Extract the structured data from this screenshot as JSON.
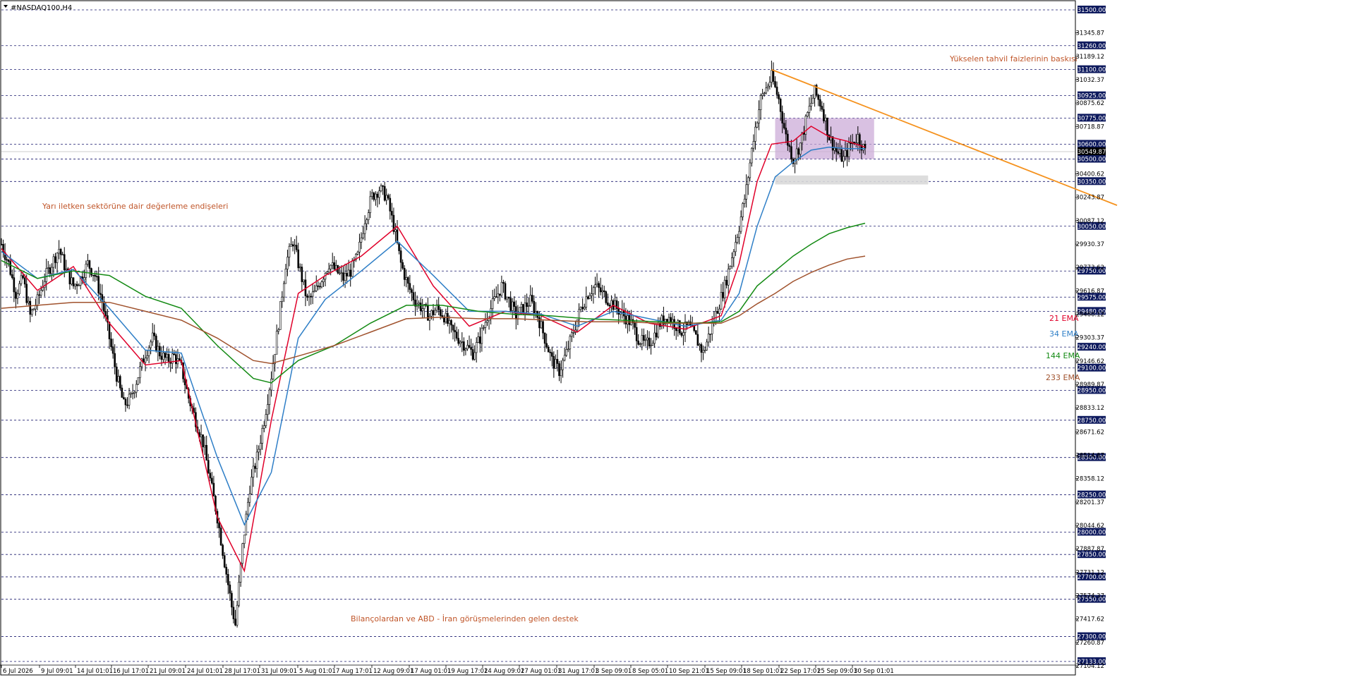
{
  "window": {
    "title": "#NASDAQ100,H4",
    "menu_icon": "triangle-down-icon"
  },
  "colors": {
    "background": "#ffffff",
    "grid_dashed": "#1a1a6e",
    "bull_bear_candles": "#000000",
    "ema21": "#e0002a",
    "ema34": "#2f7fc7",
    "ema144": "#138a13",
    "ema233": "#a0522d",
    "trendline": "#f5921e",
    "zone_fill": "#c9a6d6",
    "support_fill": "#d9d9d9",
    "annotation_text": "#c0562a",
    "price_label_bg": "#0e1a5e",
    "price_label_text": "#ffffff"
  },
  "annotations": {
    "top_right": "Yükselen tahvil faizlerinin baskısı",
    "left": "Yarı iletken sektörüne dair değerleme endişeleri",
    "bottom": "Bilançolardan ve ABD - İran görüşmelerinden gelen destek"
  },
  "legend": {
    "ema21": "21 EMA",
    "ema34": "34 EMA",
    "ema144": "144 EMA",
    "ema233": "233 EMA"
  },
  "chart_data": {
    "type": "candlestick",
    "symbol": "#NASDAQ100",
    "timeframe": "H4",
    "ylim": [
      27104.12,
      31500.0
    ],
    "x_tick_labels": [
      "6 Jul 2026",
      "9 Jul 09:01",
      "14 Jul 01:01",
      "16 Jul 17:01",
      "21 Jul 09:01",
      "24 Jul 01:01",
      "28 Jul 17:01",
      "31 Jul 09:01",
      "5 Aug 01:01",
      "7 Aug 17:01",
      "12 Aug 09:01",
      "17 Aug 01:01",
      "19 Aug 17:01",
      "24 Aug 09:01",
      "27 Aug 01:01",
      "31 Aug 17:01",
      "3 Sep 09:01",
      "8 Sep 05:01",
      "10 Sep 21:01",
      "15 Sep 09:01",
      "18 Sep 01:01",
      "22 Sep 17:01",
      "25 Sep 09:01",
      "30 Sep 01:01"
    ],
    "y_tick_labels": [
      "31345.87",
      "31189.12",
      "31032.37",
      "30875.62",
      "30718.87",
      "30400.62",
      "30243.87",
      "30087.12",
      "29930.37",
      "29773.62",
      "29616.87",
      "29460.12",
      "29303.37",
      "29146.62",
      "28989.87",
      "28833.12",
      "28671.62",
      "28514.87",
      "28358.12",
      "28201.37",
      "28044.62",
      "27887.87",
      "27731.12",
      "27574.37",
      "27417.62",
      "27260.87",
      "27104.12"
    ],
    "horizontal_levels": [
      31500.0,
      31260.0,
      31100.0,
      30925.0,
      30775.0,
      30600.0,
      30500.0,
      30350.0,
      30050.0,
      29750.0,
      29575.0,
      29480.0,
      29240.0,
      29100.0,
      28950.0,
      28750.0,
      28500.0,
      28250.0,
      28000.0,
      27850.0,
      27700.0,
      27550.0,
      27300.0,
      27133.0
    ],
    "current_price": 30549.87,
    "price_points": [
      [
        0,
        29930
      ],
      [
        4,
        29800
      ],
      [
        8,
        29600
      ],
      [
        12,
        29700
      ],
      [
        16,
        29450
      ],
      [
        20,
        29550
      ],
      [
        24,
        29700
      ],
      [
        28,
        29800
      ],
      [
        32,
        29900
      ],
      [
        36,
        29750
      ],
      [
        40,
        29650
      ],
      [
        44,
        29700
      ],
      [
        48,
        29800
      ],
      [
        52,
        29720
      ],
      [
        56,
        29550
      ],
      [
        60,
        29300
      ],
      [
        64,
        29050
      ],
      [
        68,
        28850
      ],
      [
        72,
        28900
      ],
      [
        76,
        29050
      ],
      [
        80,
        29200
      ],
      [
        84,
        29300
      ],
      [
        88,
        29200
      ],
      [
        92,
        29150
      ],
      [
        96,
        29180
      ],
      [
        100,
        29100
      ],
      [
        104,
        28900
      ],
      [
        108,
        28750
      ],
      [
        112,
        28600
      ],
      [
        116,
        28350
      ],
      [
        120,
        28100
      ],
      [
        124,
        27800
      ],
      [
        128,
        27500
      ],
      [
        130,
        27380
      ],
      [
        134,
        27900
      ],
      [
        138,
        28300
      ],
      [
        142,
        28500
      ],
      [
        146,
        28750
      ],
      [
        150,
        29050
      ],
      [
        154,
        29400
      ],
      [
        158,
        29800
      ],
      [
        162,
        29950
      ],
      [
        166,
        29750
      ],
      [
        170,
        29550
      ],
      [
        174,
        29600
      ],
      [
        178,
        29700
      ],
      [
        182,
        29800
      ],
      [
        186,
        29750
      ],
      [
        190,
        29700
      ],
      [
        194,
        29750
      ],
      [
        198,
        29850
      ],
      [
        202,
        30100
      ],
      [
        206,
        30250
      ],
      [
        210,
        30300
      ],
      [
        214,
        30250
      ],
      [
        218,
        30050
      ],
      [
        222,
        29800
      ],
      [
        226,
        29650
      ],
      [
        230,
        29550
      ],
      [
        234,
        29500
      ],
      [
        238,
        29450
      ],
      [
        242,
        29500
      ],
      [
        246,
        29450
      ],
      [
        250,
        29350
      ],
      [
        254,
        29300
      ],
      [
        258,
        29250
      ],
      [
        262,
        29200
      ],
      [
        266,
        29300
      ],
      [
        270,
        29450
      ],
      [
        274,
        29550
      ],
      [
        278,
        29650
      ],
      [
        282,
        29550
      ],
      [
        286,
        29450
      ],
      [
        290,
        29500
      ],
      [
        294,
        29550
      ],
      [
        298,
        29450
      ],
      [
        302,
        29300
      ],
      [
        306,
        29150
      ],
      [
        310,
        29080
      ],
      [
        314,
        29200
      ],
      [
        318,
        29350
      ],
      [
        322,
        29500
      ],
      [
        326,
        29600
      ],
      [
        330,
        29650
      ],
      [
        334,
        29600
      ],
      [
        338,
        29550
      ],
      [
        342,
        29500
      ],
      [
        346,
        29450
      ],
      [
        350,
        29400
      ],
      [
        354,
        29300
      ],
      [
        358,
        29250
      ],
      [
        362,
        29300
      ],
      [
        366,
        29400
      ],
      [
        370,
        29450
      ],
      [
        374,
        29400
      ],
      [
        378,
        29350
      ],
      [
        382,
        29380
      ],
      [
        386,
        29300
      ],
      [
        390,
        29200
      ],
      [
        394,
        29350
      ],
      [
        398,
        29500
      ],
      [
        402,
        29650
      ],
      [
        406,
        29850
      ],
      [
        410,
        30050
      ],
      [
        414,
        30300
      ],
      [
        418,
        30650
      ],
      [
        422,
        30900
      ],
      [
        426,
        31000
      ],
      [
        428,
        31050
      ],
      [
        432,
        30900
      ],
      [
        436,
        30650
      ],
      [
        440,
        30500
      ],
      [
        444,
        30600
      ],
      [
        448,
        30800
      ],
      [
        452,
        30950
      ],
      [
        456,
        30850
      ],
      [
        460,
        30650
      ],
      [
        464,
        30550
      ],
      [
        468,
        30500
      ],
      [
        472,
        30600
      ],
      [
        476,
        30650
      ],
      [
        480,
        30550
      ]
    ],
    "series": [
      {
        "name": "21 EMA",
        "values": [
          [
            0,
            29900
          ],
          [
            20,
            29620
          ],
          [
            40,
            29780
          ],
          [
            60,
            29400
          ],
          [
            80,
            29120
          ],
          [
            100,
            29150
          ],
          [
            120,
            28100
          ],
          [
            135,
            27740
          ],
          [
            150,
            28750
          ],
          [
            165,
            29600
          ],
          [
            180,
            29720
          ],
          [
            200,
            29850
          ],
          [
            220,
            30050
          ],
          [
            240,
            29650
          ],
          [
            260,
            29380
          ],
          [
            280,
            29480
          ],
          [
            300,
            29450
          ],
          [
            320,
            29340
          ],
          [
            340,
            29520
          ],
          [
            360,
            29400
          ],
          [
            380,
            29360
          ],
          [
            400,
            29450
          ],
          [
            410,
            29800
          ],
          [
            420,
            30350
          ],
          [
            428,
            30600
          ],
          [
            440,
            30620
          ],
          [
            450,
            30720
          ],
          [
            460,
            30650
          ],
          [
            470,
            30620
          ],
          [
            480,
            30580
          ]
        ]
      },
      {
        "name": "34 EMA",
        "values": [
          [
            0,
            29880
          ],
          [
            20,
            29700
          ],
          [
            40,
            29760
          ],
          [
            60,
            29500
          ],
          [
            80,
            29220
          ],
          [
            100,
            29200
          ],
          [
            120,
            28500
          ],
          [
            135,
            28050
          ],
          [
            150,
            28400
          ],
          [
            165,
            29300
          ],
          [
            180,
            29560
          ],
          [
            200,
            29750
          ],
          [
            220,
            29950
          ],
          [
            240,
            29720
          ],
          [
            260,
            29480
          ],
          [
            280,
            29480
          ],
          [
            300,
            29460
          ],
          [
            320,
            29380
          ],
          [
            340,
            29480
          ],
          [
            360,
            29430
          ],
          [
            380,
            29380
          ],
          [
            400,
            29420
          ],
          [
            410,
            29600
          ],
          [
            420,
            30050
          ],
          [
            430,
            30380
          ],
          [
            440,
            30480
          ],
          [
            450,
            30560
          ],
          [
            460,
            30580
          ],
          [
            470,
            30570
          ],
          [
            480,
            30570
          ]
        ]
      },
      {
        "name": "144 EMA",
        "values": [
          [
            0,
            29820
          ],
          [
            20,
            29700
          ],
          [
            40,
            29750
          ],
          [
            60,
            29720
          ],
          [
            80,
            29580
          ],
          [
            100,
            29500
          ],
          [
            120,
            29250
          ],
          [
            140,
            29030
          ],
          [
            150,
            29000
          ],
          [
            165,
            29150
          ],
          [
            185,
            29250
          ],
          [
            205,
            29400
          ],
          [
            225,
            29520
          ],
          [
            245,
            29520
          ],
          [
            265,
            29480
          ],
          [
            285,
            29460
          ],
          [
            305,
            29450
          ],
          [
            325,
            29430
          ],
          [
            345,
            29420
          ],
          [
            365,
            29410
          ],
          [
            385,
            29400
          ],
          [
            400,
            29410
          ],
          [
            410,
            29480
          ],
          [
            420,
            29650
          ],
          [
            430,
            29750
          ],
          [
            440,
            29850
          ],
          [
            450,
            29930
          ],
          [
            460,
            30000
          ],
          [
            470,
            30040
          ],
          [
            480,
            30070
          ]
        ]
      },
      {
        "name": "233 EMA",
        "values": [
          [
            0,
            29500
          ],
          [
            20,
            29520
          ],
          [
            40,
            29540
          ],
          [
            60,
            29540
          ],
          [
            80,
            29480
          ],
          [
            100,
            29420
          ],
          [
            120,
            29300
          ],
          [
            140,
            29150
          ],
          [
            150,
            29130
          ],
          [
            165,
            29180
          ],
          [
            185,
            29250
          ],
          [
            205,
            29340
          ],
          [
            225,
            29430
          ],
          [
            245,
            29440
          ],
          [
            265,
            29430
          ],
          [
            285,
            29430
          ],
          [
            305,
            29420
          ],
          [
            325,
            29410
          ],
          [
            345,
            29410
          ],
          [
            365,
            29400
          ],
          [
            385,
            29400
          ],
          [
            400,
            29400
          ],
          [
            410,
            29450
          ],
          [
            420,
            29530
          ],
          [
            430,
            29600
          ],
          [
            440,
            29680
          ],
          [
            450,
            29740
          ],
          [
            460,
            29790
          ],
          [
            470,
            29830
          ],
          [
            480,
            29850
          ]
        ]
      }
    ],
    "trendline": {
      "from": [
        428,
        31100
      ],
      "to": [
        620,
        30190
      ]
    },
    "consolidation_zone": {
      "x_from": 430,
      "x_to": 485,
      "y_from": 30500,
      "y_to": 30775
    },
    "support_zone": {
      "x_from": 430,
      "x_to": 515,
      "y_from": 30330,
      "y_to": 30390
    },
    "grid": true,
    "legend_placement": "right"
  }
}
